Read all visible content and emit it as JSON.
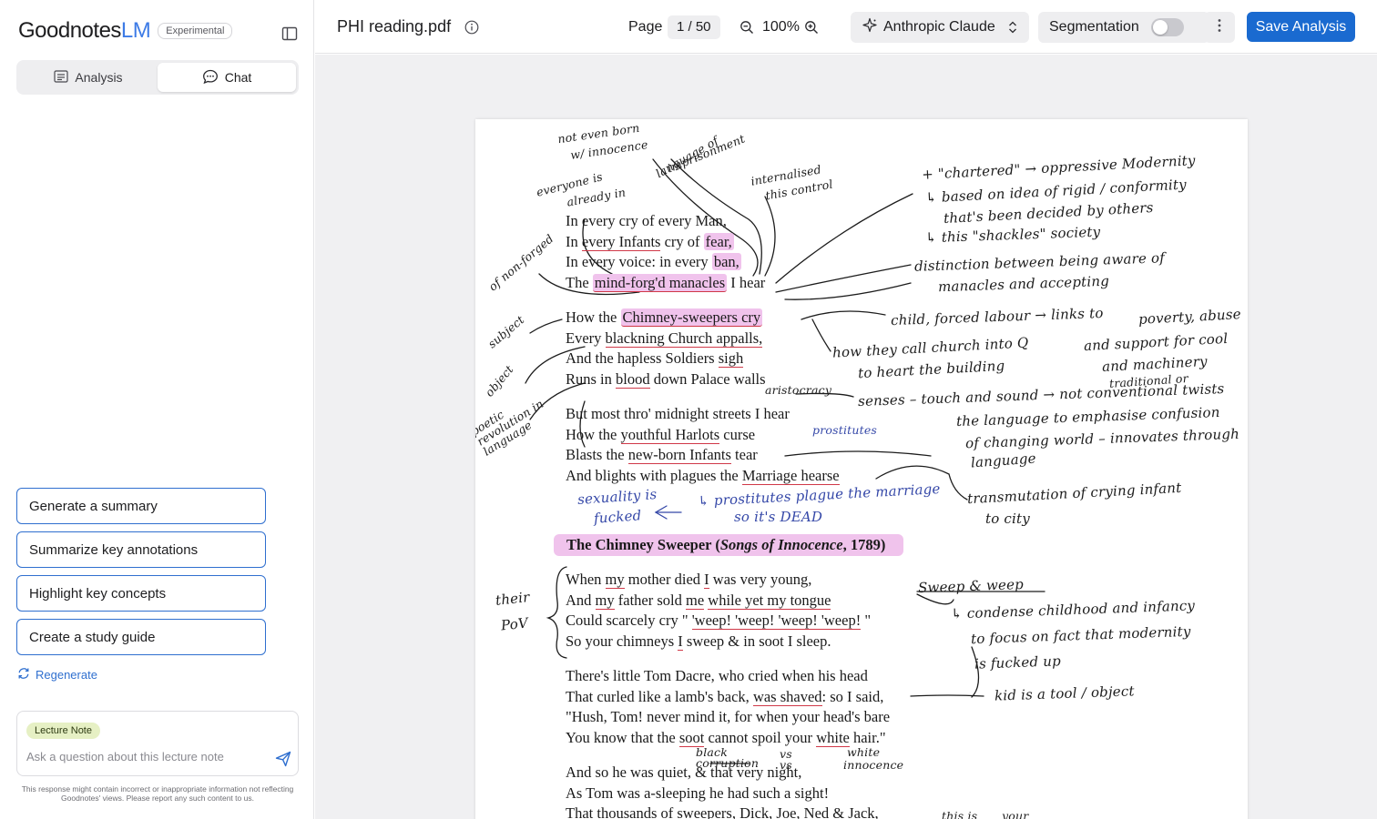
{
  "brand": {
    "name": "Goodnotes",
    "suffix": "LM",
    "badge": "Experimental"
  },
  "sidebar": {
    "tabs": [
      {
        "label": "Analysis"
      },
      {
        "label": "Chat"
      }
    ],
    "suggestions": [
      {
        "label": "Generate a summary"
      },
      {
        "label": "Summarize key annotations"
      },
      {
        "label": "Highlight key concepts"
      },
      {
        "label": "Create a study guide"
      }
    ],
    "regenerate_label": "Regenerate",
    "composer": {
      "tag": "Lecture Note",
      "placeholder": "Ask a question about this lecture note"
    },
    "disclaimer": "This response might contain incorrect or inappropriate information not reflecting Goodnotes' views. Please report any such content to us."
  },
  "toolbar": {
    "doc_title": "PHI reading.pdf",
    "page_label": "Page",
    "page_value": "1 / 50",
    "zoom": "100%",
    "model": "Anthropic Claude",
    "segmentation_label": "Segmentation",
    "segmentation_on": false,
    "save_label": "Save Analysis"
  },
  "colors": {
    "accent": "#1a6ad0",
    "highlight": "#f0c3ec",
    "underline": "#d03848",
    "ink_blue": "#3548a8"
  },
  "document": {
    "stanzas": [
      {
        "lines": [
          [
            {
              "t": "In every cry of every Man,"
            }
          ],
          [
            {
              "t": "In "
            },
            {
              "t": "every Infants",
              "u": true
            },
            {
              "t": " cry of "
            },
            {
              "t": "fear,",
              "h": true
            }
          ],
          [
            {
              "t": "In every voice: in every "
            },
            {
              "t": "ban,",
              "h": true
            }
          ],
          [
            {
              "t": "The "
            },
            {
              "t": "mind-forg'd manacles",
              "h": true,
              "u": true
            },
            {
              "t": " I hear"
            }
          ]
        ]
      },
      {
        "lines": [
          [
            {
              "t": "How the "
            },
            {
              "t": "Chimney-sweepers cry",
              "h": true,
              "u": true
            }
          ],
          [
            {
              "t": "Every "
            },
            {
              "t": "blackning Church appalls,",
              "u": true
            }
          ],
          [
            {
              "t": "And the hapless Soldiers "
            },
            {
              "t": "sigh",
              "u": true
            }
          ],
          [
            {
              "t": "Runs in "
            },
            {
              "t": "blood",
              "u": true
            },
            {
              "t": " down Palace walls"
            }
          ]
        ]
      },
      {
        "lines": [
          [
            {
              "t": "But most thro' midnight streets I hear"
            }
          ],
          [
            {
              "t": "How the "
            },
            {
              "t": "youthful Harlots",
              "u": true
            },
            {
              "t": " curse"
            }
          ],
          [
            {
              "t": "Blasts the "
            },
            {
              "t": "new-born Infants",
              "u": true
            },
            {
              "t": " tear"
            }
          ],
          [
            {
              "t": "And blights with plagues the "
            },
            {
              "t": "Marriage hearse",
              "u": true
            }
          ]
        ]
      }
    ],
    "heading": {
      "title": "The Chimney Sweeper (",
      "italic": "Songs of Innocence",
      "rest": ", 1789)"
    },
    "stanzas2": [
      {
        "lines": [
          [
            {
              "t": "When "
            },
            {
              "t": "my",
              "u": true
            },
            {
              "t": " mother died "
            },
            {
              "t": "I",
              "u": true
            },
            {
              "t": " was very young,"
            }
          ],
          [
            {
              "t": "And "
            },
            {
              "t": "my",
              "u": true
            },
            {
              "t": " father sold "
            },
            {
              "t": "me",
              "u": true
            },
            {
              "t": " "
            },
            {
              "t": "while yet my tongue",
              "u": true
            }
          ],
          [
            {
              "t": "Could scarcely cry \" "
            },
            {
              "t": "'weep! 'weep! 'weep! 'weep!",
              "u": true
            },
            {
              "t": " \""
            }
          ],
          [
            {
              "t": "So your chimneys "
            },
            {
              "t": "I",
              "u": true
            },
            {
              "t": " sweep & in soot I sleep."
            }
          ]
        ]
      },
      {
        "lines": [
          [
            {
              "t": "There's little Tom Dacre, who cried when his head"
            }
          ],
          [
            {
              "t": "That curled like a lamb's back, "
            },
            {
              "t": "was shaved",
              "u": true
            },
            {
              "t": ": so I said,"
            }
          ],
          [
            {
              "t": "\"Hush, Tom! never mind it, for when your head's bare"
            }
          ],
          [
            {
              "t": "You know that the "
            },
            {
              "t": "soot",
              "u": true
            },
            {
              "t": " cannot spoil your "
            },
            {
              "t": "white",
              "u": true
            },
            {
              "t": " hair.\""
            }
          ]
        ]
      },
      {
        "lines": [
          [
            {
              "t": "And so he was quiet, & that very night,"
            }
          ],
          [
            {
              "t": "As Tom was a-sleeping he had such a sight!"
            }
          ],
          [
            {
              "t": "That thousands of sweepers, Dick, Joe, Ned & Jack,"
            }
          ]
        ]
      }
    ],
    "notes": {
      "n_not_even": "not even born",
      "n_innocence": "w/ innocence",
      "n_language": "language of",
      "n_imprison": "imprisonment",
      "n_everyone": "everyone is",
      "n_already": "already in",
      "n_internalised": "internalised",
      "n_control": "this control",
      "n_chartered": "+ \"chartered\" → oppressive Modernity",
      "n_based": "↳ based on idea of rigid / conformity",
      "n_decided": "that's been decided by others",
      "n_shackles": "↳ this \"shackles\" society",
      "n_distinction": "distinction between being aware of",
      "n_manacles": "manacles and accepting",
      "n_child": "child, forced labour → links to",
      "n_poverty": "poverty, abuse",
      "n_support": "and support for cool",
      "n_machinery": "and machinery",
      "n_call": "how they call church into Q",
      "n_heart": "to heart the building",
      "n_traditional": "traditional or",
      "n_senses": "senses – touch and sound → not conventional twists",
      "n_emphasise": "the language to emphasise confusion",
      "n_changing": "of changing world – innovates through",
      "n_lang2": "language",
      "n_aristocracy": "aristocracy",
      "n_prostitutes": "prostitutes",
      "n_sexuality": "sexuality is",
      "n_fucked": "fucked",
      "n_plague": "↳ prostitutes plague the marriage",
      "n_dead": "so it's DEAD",
      "n_transmutation": "transmutation of crying infant",
      "n_city": "to city",
      "n_forged": "of non-forged",
      "n_subject": "subject",
      "n_object": "object",
      "n_poetic": "poetic revolution in language",
      "n_their": "their",
      "n_pov": "PoV",
      "n_sweep": "Sweep & weep",
      "n_condense": "↳ condense childhood and infancy",
      "n_focus": "to focus on fact that modernity",
      "n_fucked_up": "is fucked up",
      "n_kid": "kid is a tool / object",
      "n_black": "black",
      "n_corruption": "corruption",
      "n_vs": "vs",
      "n_white": "white",
      "n_innocence2": "innocence",
      "n_this_is": "this is",
      "n_your": "your"
    }
  }
}
